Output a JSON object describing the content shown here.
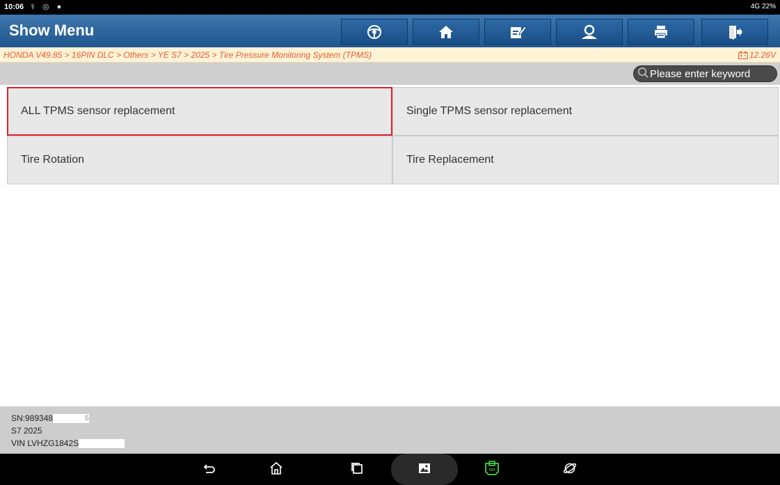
{
  "status_bar": {
    "time": "10:06",
    "right_indicators": "4G 22%"
  },
  "header": {
    "title": "Show Menu",
    "buttons": [
      {
        "name": "steering-wheel-icon"
      },
      {
        "name": "home-icon"
      },
      {
        "name": "edit-icon"
      },
      {
        "name": "user-icon"
      },
      {
        "name": "print-icon"
      },
      {
        "name": "exit-icon"
      }
    ]
  },
  "breadcrumb": {
    "path": "HONDA V49.85 > 16PIN DLC > Others > YE S7 > 2025 > Tire Pressure Monitoring System (TPMS)",
    "voltage": "12.26V"
  },
  "search": {
    "placeholder": "Please enter keyword",
    "value": ""
  },
  "menu": {
    "items": [
      {
        "label": "ALL TPMS sensor replacement",
        "selected": true
      },
      {
        "label": "Single TPMS sensor replacement",
        "selected": false
      },
      {
        "label": "Tire Rotation",
        "selected": false
      },
      {
        "label": "Tire Replacement",
        "selected": false
      }
    ]
  },
  "footer": {
    "sn": "SN:989348",
    "sn_suffix": "5",
    "model": "S7 2025",
    "vin": "VIN LVHZG1842S"
  },
  "colors": {
    "header": "#2a64a0",
    "breadcrumb_text": "#e8592f",
    "selected_border": "#e0202a",
    "vci_icon": "#3fd84a"
  },
  "nav_bar": {
    "buttons": [
      "back-icon",
      "home-nav-icon",
      "recents-icon",
      "gallery-icon",
      "vci-icon",
      "browser-icon"
    ]
  }
}
